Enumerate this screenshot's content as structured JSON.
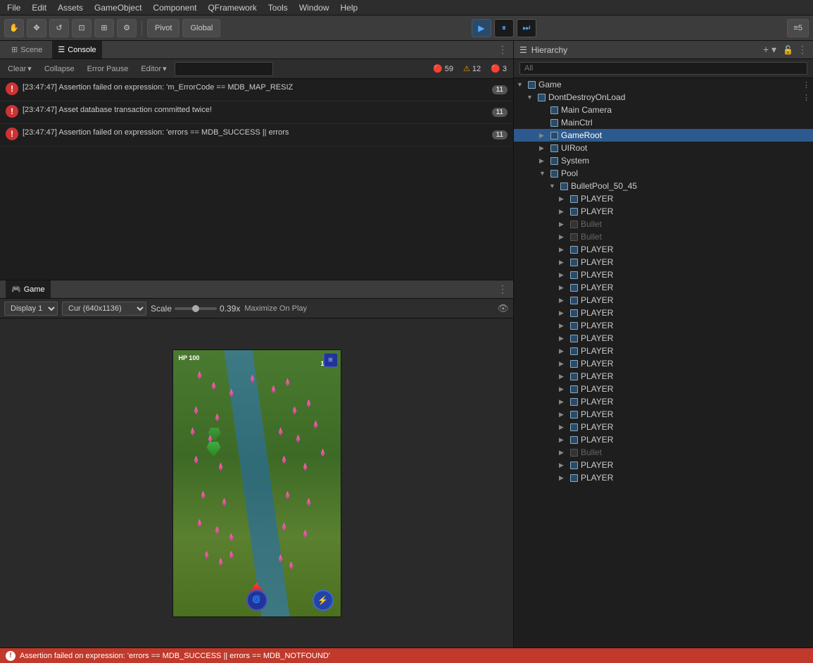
{
  "menubar": {
    "items": [
      "File",
      "Edit",
      "Assets",
      "GameObject",
      "Component",
      "QFramework",
      "Tools",
      "Window",
      "Help"
    ]
  },
  "toolbar": {
    "tools": [
      "✋",
      "✥",
      "↺",
      "⊡",
      "⊞",
      "⚙"
    ],
    "pivot_label": "Pivot",
    "global_label": "Global",
    "layers_label": "≡5"
  },
  "console": {
    "tab_scene": "Scene",
    "tab_console": "Console",
    "btn_clear": "Clear",
    "btn_collapse": "Collapse",
    "btn_error_pause": "Error Pause",
    "btn_editor": "Editor",
    "search_placeholder": "",
    "error_count": "59",
    "warn_count": "12",
    "info_count": "3",
    "messages": [
      {
        "type": "error",
        "text": "[23:47:47] Assertion failed on expression: 'm_ErrorCode == MDB_MAP_RESIZ",
        "count": "11"
      },
      {
        "type": "error",
        "text": "[23:47:47] Asset database transaction committed twice!",
        "count": "11"
      },
      {
        "type": "error",
        "text": "[23:47:47] Assertion failed on expression: 'errors == MDB_SUCCESS || errors",
        "count": "11"
      }
    ]
  },
  "game": {
    "tab_label": "Game",
    "display_label": "Display 1",
    "resolution_label": "Cur (640x1136)",
    "scale_label": "Scale",
    "scale_value": "0.39x",
    "maximize_label": "Maximize On Play",
    "hud_hp": "HP  100",
    "hud_score": "1000"
  },
  "hierarchy": {
    "title": "Hierarchy",
    "search_placeholder": "All",
    "add_icon": "+",
    "items": [
      {
        "label": "Game",
        "level": 0,
        "arrow": "▼",
        "selected": false,
        "dimmed": false
      },
      {
        "label": "DontDestroyOnLoad",
        "level": 1,
        "arrow": "▼",
        "selected": false,
        "dimmed": false
      },
      {
        "label": "Main Camera",
        "level": 2,
        "arrow": " ",
        "selected": false,
        "dimmed": false
      },
      {
        "label": "MainCtrl",
        "level": 2,
        "arrow": " ",
        "selected": false,
        "dimmed": false
      },
      {
        "label": "GameRoot",
        "level": 2,
        "arrow": "▶",
        "selected": true,
        "dimmed": false
      },
      {
        "label": "UIRoot",
        "level": 2,
        "arrow": "▶",
        "selected": false,
        "dimmed": false
      },
      {
        "label": "System",
        "level": 2,
        "arrow": "▶",
        "selected": false,
        "dimmed": false
      },
      {
        "label": "Pool",
        "level": 2,
        "arrow": "▼",
        "selected": false,
        "dimmed": false
      },
      {
        "label": "BulletPool_50_45",
        "level": 3,
        "arrow": "▼",
        "selected": false,
        "dimmed": false
      },
      {
        "label": "PLAYER",
        "level": 4,
        "arrow": "▶",
        "selected": false,
        "dimmed": false
      },
      {
        "label": "PLAYER",
        "level": 4,
        "arrow": "▶",
        "selected": false,
        "dimmed": false
      },
      {
        "label": "Bullet",
        "level": 4,
        "arrow": "▶",
        "selected": false,
        "dimmed": true
      },
      {
        "label": "Bullet",
        "level": 4,
        "arrow": "▶",
        "selected": false,
        "dimmed": true
      },
      {
        "label": "PLAYER",
        "level": 4,
        "arrow": "▶",
        "selected": false,
        "dimmed": false
      },
      {
        "label": "PLAYER",
        "level": 4,
        "arrow": "▶",
        "selected": false,
        "dimmed": false
      },
      {
        "label": "PLAYER",
        "level": 4,
        "arrow": "▶",
        "selected": false,
        "dimmed": false
      },
      {
        "label": "PLAYER",
        "level": 4,
        "arrow": "▶",
        "selected": false,
        "dimmed": false
      },
      {
        "label": "PLAYER",
        "level": 4,
        "arrow": "▶",
        "selected": false,
        "dimmed": false
      },
      {
        "label": "PLAYER",
        "level": 4,
        "arrow": "▶",
        "selected": false,
        "dimmed": false
      },
      {
        "label": "PLAYER",
        "level": 4,
        "arrow": "▶",
        "selected": false,
        "dimmed": false
      },
      {
        "label": "PLAYER",
        "level": 4,
        "arrow": "▶",
        "selected": false,
        "dimmed": false
      },
      {
        "label": "PLAYER",
        "level": 4,
        "arrow": "▶",
        "selected": false,
        "dimmed": false
      },
      {
        "label": "PLAYER",
        "level": 4,
        "arrow": "▶",
        "selected": false,
        "dimmed": false
      },
      {
        "label": "PLAYER",
        "level": 4,
        "arrow": "▶",
        "selected": false,
        "dimmed": false
      },
      {
        "label": "PLAYER",
        "level": 4,
        "arrow": "▶",
        "selected": false,
        "dimmed": false
      },
      {
        "label": "PLAYER",
        "level": 4,
        "arrow": "▶",
        "selected": false,
        "dimmed": false
      },
      {
        "label": "PLAYER",
        "level": 4,
        "arrow": "▶",
        "selected": false,
        "dimmed": false
      },
      {
        "label": "PLAYER",
        "level": 4,
        "arrow": "▶",
        "selected": false,
        "dimmed": false
      },
      {
        "label": "PLAYER",
        "level": 4,
        "arrow": "▶",
        "selected": false,
        "dimmed": false
      },
      {
        "label": "Bullet",
        "level": 4,
        "arrow": "▶",
        "selected": false,
        "dimmed": true
      },
      {
        "label": "PLAYER",
        "level": 4,
        "arrow": "▶",
        "selected": false,
        "dimmed": false
      },
      {
        "label": "PLAYER",
        "level": 4,
        "arrow": "▶",
        "selected": false,
        "dimmed": false
      }
    ]
  },
  "statusbar": {
    "text": "Assertion failed on expression: 'errors == MDB_SUCCESS || errors == MDB_NOTFOUND'",
    "error_icon": "!"
  }
}
